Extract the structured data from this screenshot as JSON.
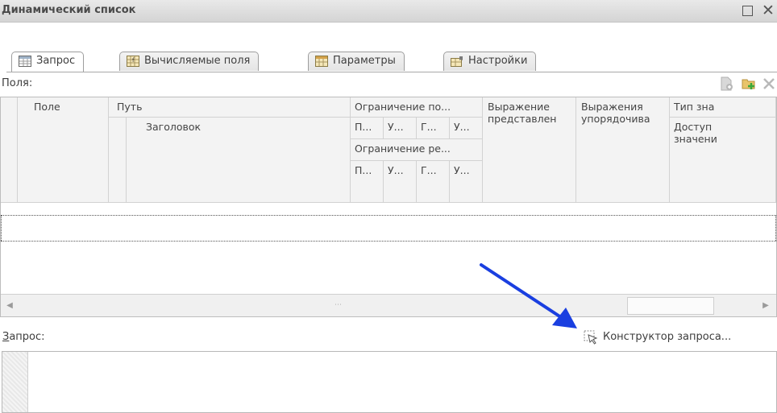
{
  "window": {
    "title": "Динамический список",
    "maximize_icon": "maximize-icon",
    "close_label": "✕"
  },
  "tabs": [
    {
      "label": "Запрос",
      "icon": "table-icon",
      "active": true
    },
    {
      "label": "Вычисляемые поля",
      "icon": "function-icon",
      "active": false
    },
    {
      "label": "Параметры",
      "icon": "parameters-icon",
      "active": false
    },
    {
      "label": "Настройки",
      "icon": "settings-icon",
      "active": false
    }
  ],
  "fields": {
    "label": "Поля:",
    "toolbar_icons": [
      "edit-field-icon",
      "add-field-icon",
      "delete-field-icon"
    ],
    "columns": {
      "field": "Поле",
      "path": "Путь",
      "header": "Заголовок",
      "restriction_fields": "Ограничение по...",
      "restriction_fields_sub": [
        "П...",
        "У...",
        "Г...",
        "У..."
      ],
      "restriction_details": "Ограничение ре...",
      "restriction_details_sub": [
        "П...",
        "У...",
        "Г...",
        "У..."
      ],
      "presentation_expr": "Выражение представлен",
      "order_expr": "Выражения упорядочива",
      "value_type": "Тип зна",
      "available_values": "Доступ значени"
    }
  },
  "query": {
    "label_accel": "З",
    "label_rest": "апрос:",
    "builder_label": "Конструктор запроса...",
    "builder_icon": "query-builder-icon"
  },
  "colors": {
    "arrow": "#1a3fe0",
    "tab_border": "#9d9d9d",
    "header_bg": "#f3f3f3"
  }
}
